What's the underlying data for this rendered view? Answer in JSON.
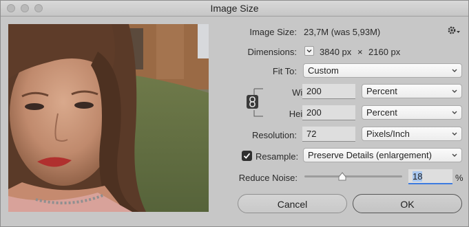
{
  "window": {
    "title": "Image Size"
  },
  "image_size": {
    "label": "Image Size:",
    "value": "23,7M (was 5,93M)"
  },
  "dimensions": {
    "label": "Dimensions:",
    "width": "3840 px",
    "times": "×",
    "height": "2160 px"
  },
  "fit_to": {
    "label": "Fit To:",
    "value": "Custom"
  },
  "width": {
    "label": "Width:",
    "value": "200",
    "unit": "Percent"
  },
  "height": {
    "label": "Height:",
    "value": "200",
    "unit": "Percent"
  },
  "resolution": {
    "label": "Resolution:",
    "value": "72",
    "unit": "Pixels/Inch"
  },
  "resample": {
    "label": "Resample:",
    "checked": true,
    "method": "Preserve Details (enlargement)"
  },
  "reduce_noise": {
    "label": "Reduce Noise:",
    "value": "18",
    "unit": "%",
    "level_percent": 18
  },
  "buttons": {
    "cancel": "Cancel",
    "ok": "OK"
  },
  "icons": {
    "settings": "gear-icon",
    "constrain": "chain-link-icon"
  }
}
